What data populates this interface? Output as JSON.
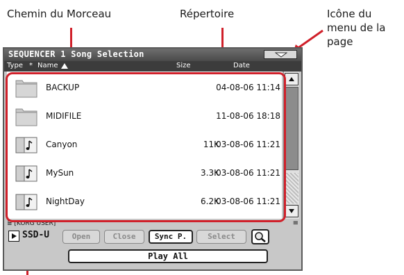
{
  "callouts": {
    "song_path": "Chemin du Morceau",
    "directory": "Répertoire",
    "page_menu_icon": "Icône du menu de la page"
  },
  "header": {
    "title": "SEQUENCER 1  Song Selection",
    "columns": {
      "type": "Type",
      "star": "*",
      "name": "Name",
      "size": "Size",
      "date": "Date"
    }
  },
  "files": [
    {
      "type": "folder-icon",
      "name": "BACKUP",
      "size": "",
      "date": "04-08-06 11:14"
    },
    {
      "type": "folder-icon",
      "name": "MIDIFILE",
      "size": "",
      "date": "11-08-06 18:18"
    },
    {
      "type": "song-icon",
      "name": "Canyon",
      "size": "11K",
      "date": "03-08-06 11:21"
    },
    {
      "type": "song-icon",
      "name": "MySun",
      "size": "3.3K",
      "date": "03-08-06 11:21"
    },
    {
      "type": "song-icon",
      "name": "NightDay",
      "size": "6.2K",
      "date": "03-08-06 11:21"
    }
  ],
  "path": "≣ [KORG USER]",
  "device": "SSD-U",
  "buttons": {
    "open": "Open",
    "close": "Close",
    "sync": "Sync P.",
    "select": "Select",
    "play_all": "Play All"
  },
  "colors": {
    "accent": "#d0202a",
    "titlebar": "#5a5a5a",
    "screen_bg": "#c8c8c8"
  }
}
